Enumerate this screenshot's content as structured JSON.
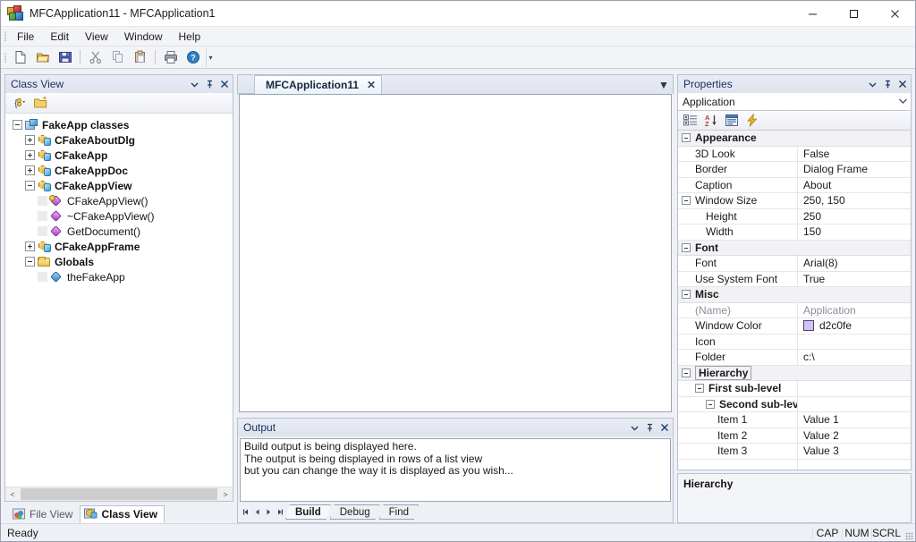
{
  "window": {
    "title": "MFCApplication11 - MFCApplication1",
    "icon": "mfc-app-icon",
    "minimize_label": "Minimize",
    "maximize_label": "Maximize",
    "close_label": "Close"
  },
  "menubar": {
    "items": [
      {
        "label": "File"
      },
      {
        "label": "Edit"
      },
      {
        "label": "View"
      },
      {
        "label": "Window"
      },
      {
        "label": "Help"
      }
    ]
  },
  "toolbar": {
    "buttons": [
      {
        "name": "new-document-icon",
        "title": "New"
      },
      {
        "name": "open-folder-icon",
        "title": "Open"
      },
      {
        "name": "save-disk-icon",
        "title": "Save"
      },
      {
        "name": "cut-scissors-icon",
        "title": "Cut"
      },
      {
        "name": "copy-icon",
        "title": "Copy"
      },
      {
        "name": "paste-clipboard-icon",
        "title": "Paste"
      },
      {
        "name": "print-icon",
        "title": "Print"
      },
      {
        "name": "help-question-icon",
        "title": "About"
      }
    ],
    "overflow_label": "Toolbar Options"
  },
  "class_view": {
    "caption": "Class View",
    "caption_buttons": [
      "window-position-chevron-icon",
      "auto-hide-pin-icon",
      "close-icon"
    ],
    "toolbar": [
      {
        "name": "class-view-new-folder-dropdown-icon"
      },
      {
        "name": "new-folder-icon"
      }
    ],
    "tree": [
      {
        "label": "FakeApp classes",
        "depth": 0,
        "expander": "minus",
        "icon": "project-icon",
        "style": "bold"
      },
      {
        "label": "CFakeAboutDlg",
        "depth": 1,
        "expander": "plus",
        "icon": "class-icon",
        "style": "bold"
      },
      {
        "label": "CFakeApp",
        "depth": 1,
        "expander": "plus",
        "icon": "class-icon",
        "style": "bold"
      },
      {
        "label": "CFakeAppDoc",
        "depth": 1,
        "expander": "plus",
        "icon": "class-icon",
        "style": "bold"
      },
      {
        "label": "CFakeAppView",
        "depth": 1,
        "expander": "minus",
        "icon": "class-icon",
        "style": "bold"
      },
      {
        "label": "CFakeAppView()",
        "depth": 2,
        "expander": "none",
        "icon": "method-key-icon",
        "style": "normal"
      },
      {
        "label": "~CFakeAppView()",
        "depth": 2,
        "expander": "none",
        "icon": "method-icon",
        "style": "normal"
      },
      {
        "label": "GetDocument()",
        "depth": 2,
        "expander": "none",
        "icon": "method-icon",
        "style": "normal"
      },
      {
        "label": "CFakeAppFrame",
        "depth": 1,
        "expander": "plus",
        "icon": "class-icon",
        "style": "bold"
      },
      {
        "label": "Globals",
        "depth": 1,
        "expander": "minus",
        "icon": "folder-icon",
        "style": "bold"
      },
      {
        "label": "theFakeApp",
        "depth": 2,
        "expander": "none",
        "icon": "variable-icon",
        "style": "normal"
      }
    ],
    "scroll_left_label": "<",
    "scroll_right_label": ">"
  },
  "left_tabs": [
    {
      "label": "File View",
      "active": false,
      "icon": "file-view-icon"
    },
    {
      "label": "Class View",
      "active": true,
      "icon": "class-view-icon"
    }
  ],
  "document": {
    "tabs": [
      {
        "label": "MFCApplication11",
        "active": true,
        "close_label": "✕"
      }
    ],
    "tab_list_menu": "▼"
  },
  "output": {
    "caption": "Output",
    "caption_buttons": [
      "window-position-chevron-icon",
      "auto-hide-pin-icon",
      "close-icon"
    ],
    "lines": [
      "Build output is being displayed here.",
      "The output is being displayed in rows of a list view",
      "but you can change the way it is displayed as you wish..."
    ],
    "nav": [
      "⏮",
      "◀",
      "▶",
      "⏭"
    ],
    "tabs": [
      {
        "label": "Build",
        "active": true
      },
      {
        "label": "Debug",
        "active": false
      },
      {
        "label": "Find",
        "active": false
      }
    ]
  },
  "properties": {
    "caption": "Properties",
    "caption_buttons": [
      "window-position-chevron-icon",
      "auto-hide-pin-icon",
      "close-icon"
    ],
    "object_selector": {
      "value": "Application",
      "chevron": "⌄"
    },
    "toolbar": [
      {
        "name": "categorized-view-icon",
        "title": "Categorized"
      },
      {
        "name": "alphabetical-sort-icon",
        "title": "Alphabetical"
      },
      {
        "name": "property-pages-icon",
        "title": "Property Pages"
      },
      {
        "name": "events-lightning-icon",
        "title": "Events"
      }
    ],
    "rows": [
      {
        "kind": "category",
        "name": "Appearance",
        "value": "",
        "indent": 0,
        "expander": true
      },
      {
        "kind": "prop",
        "name": "3D Look",
        "value": "False",
        "indent": 1,
        "expander": false
      },
      {
        "kind": "prop",
        "name": "Border",
        "value": "Dialog Frame",
        "indent": 1,
        "expander": false
      },
      {
        "kind": "prop",
        "name": "Caption",
        "value": "About",
        "indent": 1,
        "expander": false
      },
      {
        "kind": "prop",
        "name": "Window Size",
        "value": "250, 150",
        "indent": 0,
        "expander": true
      },
      {
        "kind": "prop",
        "name": "Height",
        "value": "250",
        "indent": 2,
        "expander": false
      },
      {
        "kind": "prop",
        "name": "Width",
        "value": "150",
        "indent": 2,
        "expander": false
      },
      {
        "kind": "category",
        "name": "Font",
        "value": "",
        "indent": 0,
        "expander": true
      },
      {
        "kind": "prop",
        "name": "Font",
        "value": "Arial(8)",
        "indent": 1,
        "expander": false
      },
      {
        "kind": "prop",
        "name": "Use System Font",
        "value": "True",
        "indent": 1,
        "expander": false
      },
      {
        "kind": "category",
        "name": "Misc",
        "value": "",
        "indent": 0,
        "expander": true
      },
      {
        "kind": "prop",
        "name": "(Name)",
        "value": "Application",
        "indent": 1,
        "expander": false,
        "dim": true
      },
      {
        "kind": "prop",
        "name": "Window Color",
        "value": "d2c0fe",
        "indent": 1,
        "expander": false,
        "swatch": "#d2c0fe"
      },
      {
        "kind": "prop",
        "name": "Icon",
        "value": "",
        "indent": 1,
        "expander": false
      },
      {
        "kind": "prop",
        "name": "Folder",
        "value": "c:\\",
        "indent": 1,
        "expander": false
      },
      {
        "kind": "category",
        "name": "Hierarchy",
        "value": "",
        "indent": 0,
        "expander": true,
        "selected": true
      },
      {
        "kind": "group",
        "name": "First sub-level",
        "value": "",
        "indent": 1,
        "expander": true
      },
      {
        "kind": "group",
        "name": "Second sub-level",
        "value": "",
        "indent": 2,
        "expander": true
      },
      {
        "kind": "prop",
        "name": "Item 1",
        "value": "Value 1",
        "indent": 3,
        "expander": false
      },
      {
        "kind": "prop",
        "name": "Item 2",
        "value": "Value 2",
        "indent": 3,
        "expander": false
      },
      {
        "kind": "prop",
        "name": "Item 3",
        "value": "Value 3",
        "indent": 3,
        "expander": false
      },
      {
        "kind": "blank",
        "name": "",
        "value": "",
        "indent": 0,
        "expander": false
      }
    ],
    "description_title": "Hierarchy"
  },
  "statusbar": {
    "message": "Ready",
    "indicators": [
      {
        "label": "CAP"
      },
      {
        "label": "NUM"
      },
      {
        "label": "SCRL"
      }
    ]
  }
}
